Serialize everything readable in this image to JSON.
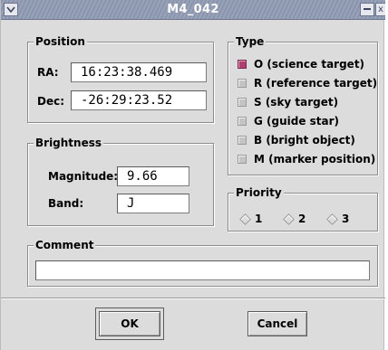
{
  "window": {
    "title": "M4_042",
    "menu_icon": "chevron-down-icon",
    "minimize_icon": "minimize-icon",
    "close_icon": "close-icon",
    "close_glyph": "x"
  },
  "position": {
    "legend": "Position",
    "ra_label": "RA:",
    "ra_value": "16:23:38.469",
    "dec_label": "Dec:",
    "dec_value": "-26:29:23.52"
  },
  "brightness": {
    "legend": "Brightness",
    "magnitude_label": "Magnitude:",
    "magnitude_value": "9.66",
    "band_label": "Band:",
    "band_value": "J"
  },
  "type": {
    "legend": "Type",
    "options": [
      {
        "label": "O (science target)",
        "checked": true
      },
      {
        "label": "R (reference target)",
        "checked": false
      },
      {
        "label": "S (sky target)",
        "checked": false
      },
      {
        "label": "G (guide star)",
        "checked": false
      },
      {
        "label": "B (bright object)",
        "checked": false
      },
      {
        "label": "M (marker position)",
        "checked": false
      }
    ]
  },
  "priority": {
    "legend": "Priority",
    "options": [
      "1",
      "2",
      "3"
    ]
  },
  "comment": {
    "legend": "Comment",
    "value": ""
  },
  "buttons": {
    "ok": "OK",
    "cancel": "Cancel"
  },
  "colors": {
    "checked_accent": "#b04070",
    "titlebar": "#8a94ac"
  }
}
